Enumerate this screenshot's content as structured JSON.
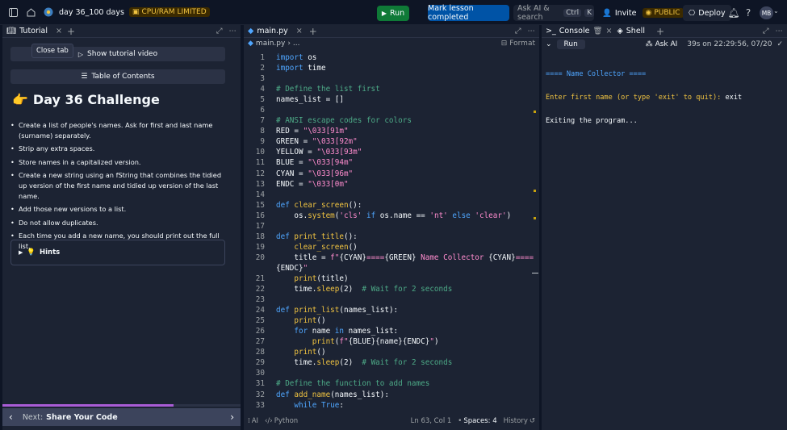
{
  "topbar": {
    "repl_name": "day 36_100 days",
    "cpu_badge": "CPU/RAM LIMITED",
    "run_label": "Run",
    "mark_label": "Mark lesson completed",
    "askai_label": "Ask AI & search",
    "kbd_ctrl": "Ctrl",
    "kbd_k": "K",
    "invite_label": "Invite",
    "public_label": "PUBLIC",
    "deploy_label": "Deploy",
    "avatar_initials": "MB"
  },
  "left": {
    "tab_label": "Tutorial",
    "tooltip": "Close tab",
    "video_btn": "Show tutorial video",
    "toc_btn": "Table of Contents",
    "title_emoji": "👉",
    "title": "Day 36 Challenge",
    "tasks": [
      "Create a list of people's names. Ask for first and last name (surname) separately.",
      "Strip any extra spaces.",
      "Store names in a capitalized version.",
      "Create a new string using an fString that combines the tidied up version of the first name and tidied up version of the last name.",
      "Add those new versions to a list.",
      "Do not allow duplicates.",
      "Each time you add a new name, you should print out the full list."
    ],
    "hints_label": "Hints",
    "progress": 0.72,
    "next_prefix": "Next:",
    "next_title": "Share Your Code"
  },
  "editor": {
    "tab_label": "main.py",
    "breadcrumb_file": "main.py",
    "breadcrumb_rest": "...",
    "format_label": "Format",
    "status_ai": "AI",
    "status_lang": "Python",
    "status_pos": "Ln 63, Col 1",
    "status_spaces": "Spaces: 4",
    "status_history": "History"
  },
  "console": {
    "tab_console": "Console",
    "tab_shell": "Shell",
    "run_label": "Run",
    "askai_label": "Ask AI",
    "run_info": "39s on 22:29:56, 07/20",
    "line1": "==== Name Collector ====",
    "line2_prompt": "Enter first name (or type 'exit' to quit): ",
    "line2_input": "exit",
    "line3": "Exiting the program..."
  },
  "code_lines": [
    {
      "n": "1",
      "h": "<span class=\"kw\">import</span> os"
    },
    {
      "n": "2",
      "h": "<span class=\"kw\">import</span> time"
    },
    {
      "n": "3",
      "h": ""
    },
    {
      "n": "4",
      "h": "<span class=\"cm\"># Define the list first</span>"
    },
    {
      "n": "5",
      "h": "names_list = []"
    },
    {
      "n": "6",
      "h": ""
    },
    {
      "n": "7",
      "h": "<span class=\"cm\"># ANSI escape codes for colors</span>"
    },
    {
      "n": "8",
      "h": "RED = <span class=\"str\">\"\\033[91m\"</span>"
    },
    {
      "n": "9",
      "h": "GREEN = <span class=\"str\">\"\\033[92m\"</span>"
    },
    {
      "n": "10",
      "h": "YELLOW = <span class=\"str\">\"\\033[93m\"</span>"
    },
    {
      "n": "11",
      "h": "BLUE = <span class=\"str\">\"\\033[94m\"</span>"
    },
    {
      "n": "12",
      "h": "CYAN = <span class=\"str\">\"\\033[96m\"</span>"
    },
    {
      "n": "13",
      "h": "ENDC = <span class=\"str\">\"\\033[0m\"</span>"
    },
    {
      "n": "14",
      "h": ""
    },
    {
      "n": "15",
      "h": "<span class=\"kw\">def</span> <span class=\"fn\">clear_screen</span>():"
    },
    {
      "n": "16",
      "h": "    os.<span class=\"fn\">system</span>(<span class=\"str\">'cls'</span> <span class=\"kw\">if</span> os.name == <span class=\"str\">'nt'</span> <span class=\"kw\">else</span> <span class=\"str\">'clear'</span>)"
    },
    {
      "n": "17",
      "h": ""
    },
    {
      "n": "18",
      "h": "<span class=\"kw\">def</span> <span class=\"fn\">print_title</span>():"
    },
    {
      "n": "19",
      "h": "    <span class=\"fn\">clear_screen</span>()"
    },
    {
      "n": "20",
      "h": "    title = <span class=\"str\">f\"</span>{CYAN}<span class=\"str\">====</span>{GREEN}<span class=\"str\"> Name Collector </span>{CYAN}<span class=\"str\">====</span>"
    },
    {
      "n": "",
      "h": "{ENDC}<span class=\"str\">\"</span>"
    },
    {
      "n": "21",
      "h": "    <span class=\"fn\">print</span>(title)"
    },
    {
      "n": "22",
      "h": "    time.<span class=\"fn\">sleep</span>(2)  <span class=\"cm\"># Wait for 2 seconds</span>"
    },
    {
      "n": "23",
      "h": ""
    },
    {
      "n": "24",
      "h": "<span class=\"kw\">def</span> <span class=\"fn\">print_list</span>(names_list):"
    },
    {
      "n": "25",
      "h": "    <span class=\"fn\">print</span>()"
    },
    {
      "n": "26",
      "h": "    <span class=\"kw\">for</span> name <span class=\"kw\">in</span> names_list:"
    },
    {
      "n": "27",
      "h": "        <span class=\"fn\">print</span>(<span class=\"str\">f\"</span>{BLUE}{name}{ENDC}<span class=\"str\">\"</span>)"
    },
    {
      "n": "28",
      "h": "    <span class=\"fn\">print</span>()"
    },
    {
      "n": "29",
      "h": "    time.<span class=\"fn\">sleep</span>(2)  <span class=\"cm\"># Wait for 2 seconds</span>"
    },
    {
      "n": "30",
      "h": ""
    },
    {
      "n": "31",
      "h": "<span class=\"cm\"># Define the function to add names</span>"
    },
    {
      "n": "32",
      "h": "<span class=\"kw\">def</span> <span class=\"fn\">add_name</span>(names_list):"
    },
    {
      "n": "33",
      "h": "    <span class=\"kw\">while</span> <span class=\"kw\">True</span>:"
    }
  ]
}
